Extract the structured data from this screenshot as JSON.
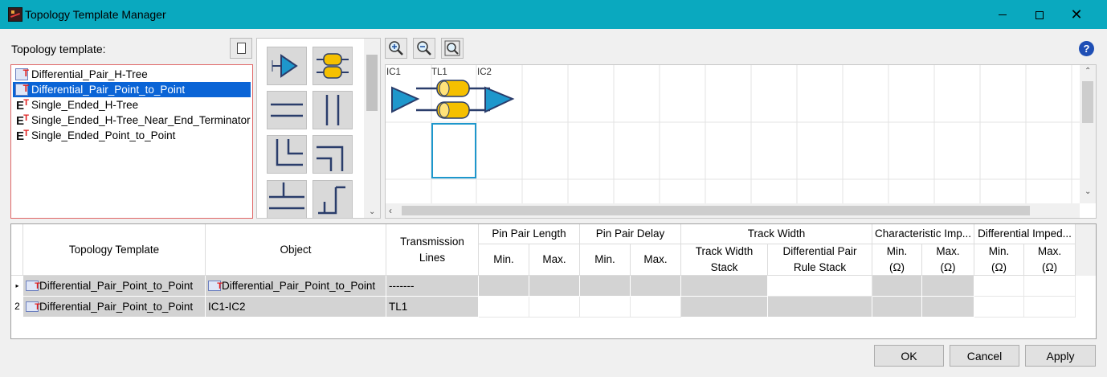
{
  "window": {
    "title": "Topology Template Manager"
  },
  "templates": {
    "label": "Topology template:",
    "items": [
      {
        "label": "Differential_Pair_H-Tree",
        "icon": "diff-pair-template-icon"
      },
      {
        "label": "Differential_Pair_Point_to_Point",
        "icon": "diff-pair-template-icon"
      },
      {
        "label": "Single_Ended_H-Tree",
        "icon": "single-ended-template-icon"
      },
      {
        "label": "Single_Ended_H-Tree_Near_End_Terminator",
        "icon": "single-ended-template-icon"
      },
      {
        "label": "Single_Ended_Point_to_Point",
        "icon": "single-ended-template-icon"
      }
    ],
    "selected_index": 1
  },
  "canvas": {
    "labels": {
      "ic1": "IC1",
      "tl1": "TL1",
      "ic2": "IC2"
    }
  },
  "grid": {
    "headers": {
      "topology_template": "Topology Template",
      "object": "Object",
      "transmission_lines_1": "Transmission",
      "transmission_lines_2": "Lines",
      "pin_pair_length": "Pin Pair Length",
      "pin_pair_delay": "Pin Pair Delay",
      "track_width": "Track Width",
      "char_imp": "Characteristic Imp...",
      "diff_imp": "Differential Imped...",
      "min": "Min.",
      "max": "Max.",
      "track_width_stack_1": "Track Width",
      "track_width_stack_2": "Stack",
      "diff_pair_rule_stack_1": "Differential Pair",
      "diff_pair_rule_stack_2": "Rule Stack",
      "ohm": "(Ω)"
    },
    "rows": [
      {
        "header": "",
        "topology_template": "Differential_Pair_Point_to_Point",
        "object": "Differential_Pair_Point_to_Point",
        "transmission_lines": "-------"
      },
      {
        "header": "2",
        "topology_template": "Differential_Pair_Point_to_Point",
        "object": "IC1-IC2",
        "transmission_lines": "TL1"
      }
    ]
  },
  "buttons": {
    "ok": "OK",
    "cancel": "Cancel",
    "apply": "Apply"
  },
  "colors": {
    "titlebar": "#0aa9bf",
    "selection": "#0a64d6",
    "component_fill": "#1e97cc",
    "line_fill": "#f5c000",
    "wire": "#2a3d6b"
  }
}
